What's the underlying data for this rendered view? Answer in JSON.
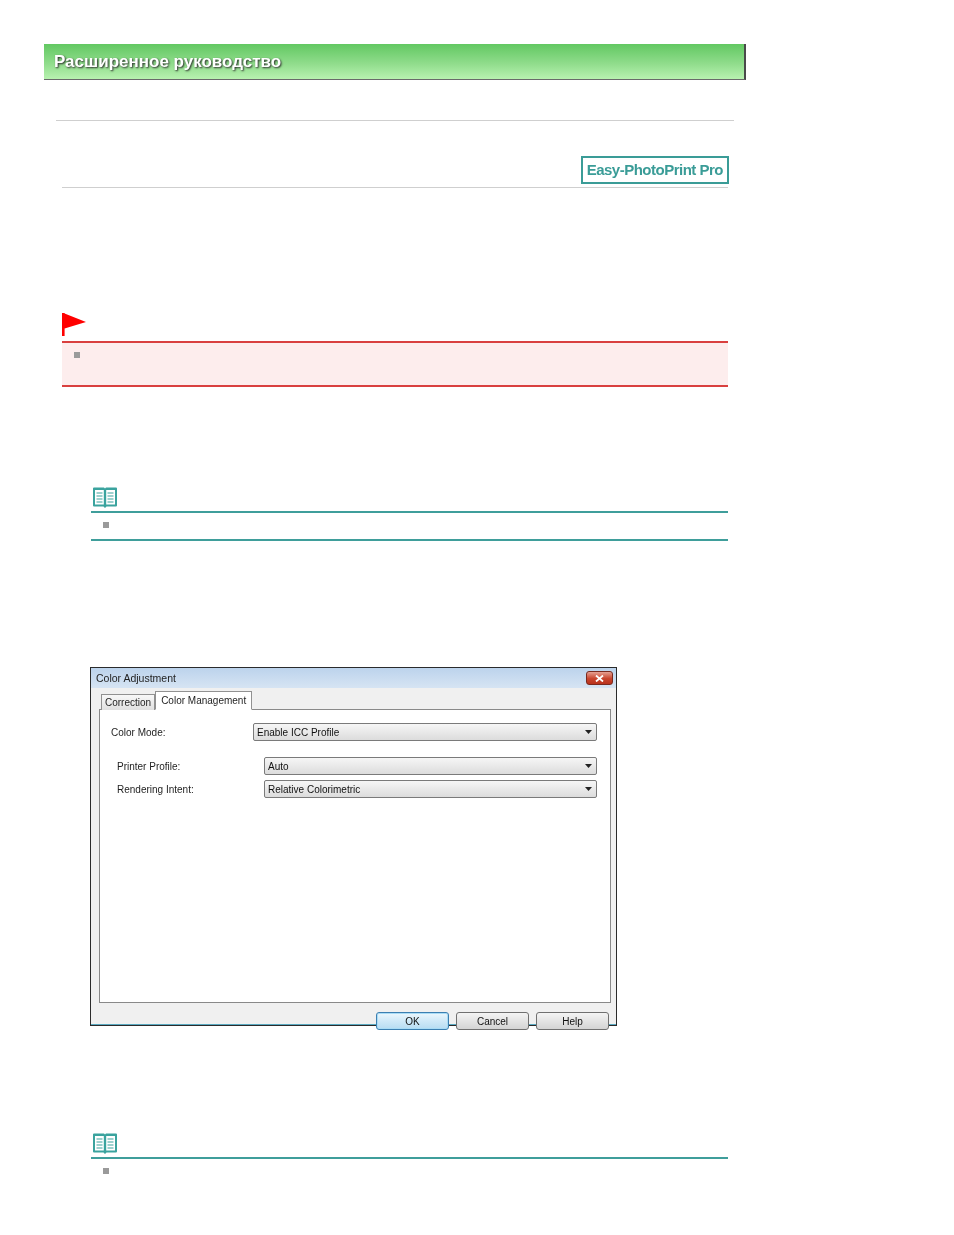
{
  "header": {
    "title": "Расширенное руководство"
  },
  "product_logo": {
    "text": "Easy-PhotoPrint Pro"
  },
  "blocks": [
    {
      "kind": "caution"
    },
    {
      "kind": "note",
      "bottom_border": true
    },
    {
      "kind": "dialog",
      "title": "Color Adjustment",
      "tabs": [
        {
          "label": "Correction",
          "selected": false
        },
        {
          "label": "Color Management",
          "selected": true
        }
      ],
      "fields": [
        {
          "label": "Color Mode:",
          "value": "Enable ICC Profile",
          "children": [
            {
              "label": "Printer Profile:",
              "value": "Auto"
            },
            {
              "label": "Rendering Intent:",
              "value": "Relative Colorimetric"
            }
          ]
        }
      ],
      "buttons": [
        {
          "label": "OK",
          "default": true
        },
        {
          "label": "Cancel",
          "default": false
        },
        {
          "label": "Help",
          "default": false
        }
      ]
    },
    {
      "kind": "note",
      "bottom_border": false
    }
  ]
}
